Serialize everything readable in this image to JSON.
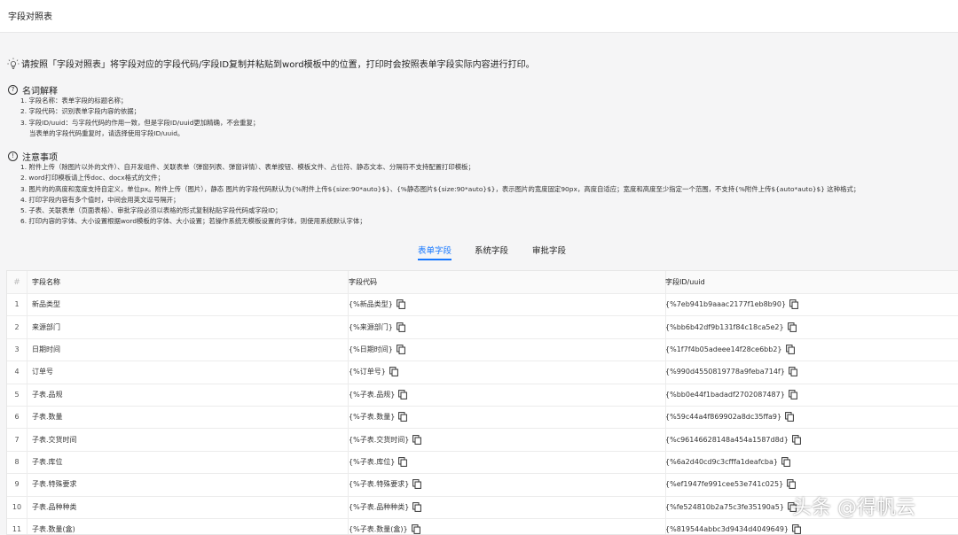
{
  "header": {
    "title": "字段对照表"
  },
  "tip": "请按照「字段对照表」将字段对应的字段代码/字段ID复制并粘贴到word模板中的位置，打印时会按照表单字段实际内容进行打印。",
  "glossary": {
    "title": "名词解释",
    "lines": [
      "1. 字段名称：表单字段的标题名称；",
      "2. 字段代码：识别表单字段内容的依据；",
      "3. 字段ID/uuid：与字段代码的作用一致，但是字段ID/uuid更加精确，不会重复；",
      "当表单的字段代码重复时，请选择使用字段ID/uuid。"
    ]
  },
  "notes": {
    "title": "注意事项",
    "lines": [
      "1. 附件上传（除图片以外的文件）、自开发组件、关联表单（弹窗列表、弹窗详情）、表单按钮、模板文件、占位符、静态文本、分隔符不支持配置打印模板；",
      "2. word打印模板请上传doc、docx格式的文件；",
      "3. 图片的的高度和宽度支持自定义，单位px。附件上传（图片），静态 图片的字段代码默认为{%附件上传${size:90*auto}$}、{%静态图片${size:90*auto}$}，表示图片的宽度固定90px，高度自适应；宽度和高度至少指定一个范围，不支持{%附件上传${auto*auto}$} 这种格式；",
      "4. 打印字段内容有多个值时，中间会用英文逗号隔开；",
      "5. 子表、关联表单（页面表格）、审批字段必须以表格的形式复制粘贴字段代码或字段ID；",
      "6. 打印内容的字体、大小设置根据word模板的字体、大小设置；若操作系统无模板设置的字体，则使用系统默认字体；"
    ]
  },
  "tabs": [
    {
      "label": "表单字段",
      "active": true
    },
    {
      "label": "系统字段",
      "active": false
    },
    {
      "label": "审批字段",
      "active": false
    }
  ],
  "table": {
    "columns": {
      "no": "#",
      "name": "字段名称",
      "code": "字段代码",
      "id": "字段ID/uuid"
    },
    "rows": [
      {
        "no": "1",
        "name": "新品类型",
        "code": "{%新品类型}",
        "id": "{%7eb941b9aaac2177f1eb8b90}"
      },
      {
        "no": "2",
        "name": "来源部门",
        "code": "{%来源部门}",
        "id": "{%bb6b42df9b131f84c18ca5e2}"
      },
      {
        "no": "3",
        "name": "日期时间",
        "code": "{%日期时间}",
        "id": "{%1f7f4b05adeee14f28ce6bb2}"
      },
      {
        "no": "4",
        "name": "订单号",
        "code": "{%订单号}",
        "id": "{%990d4550819778a9feba714f}"
      },
      {
        "no": "5",
        "name": "子表.品规",
        "code": "{%子表.品规}",
        "id": "{%bb0e44f1badadf2702087487}"
      },
      {
        "no": "6",
        "name": "子表.数量",
        "code": "{%子表.数量}",
        "id": "{%59c44a4f869902a8dc35ffa9}"
      },
      {
        "no": "7",
        "name": "子表.交货时间",
        "code": "{%子表.交货时间}",
        "id": "{%c96146628148a454a1587d8d}"
      },
      {
        "no": "8",
        "name": "子表.库位",
        "code": "{%子表.库位}",
        "id": "{%6a2d40cd9c3cfffa1deafcba}"
      },
      {
        "no": "9",
        "name": "子表.特殊要求",
        "code": "{%子表.特殊要求}",
        "id": "{%ef1947fe991cee53e741c025}"
      },
      {
        "no": "10",
        "name": "子表.品种种类",
        "code": "{%子表.品种种类}",
        "id": "{%fe524810b2a75c3fe35190a5}"
      },
      {
        "no": "11",
        "name": "子表.数量(盒)",
        "code": "{%子表.数量(盒)}",
        "id": "{%819544abbc3d9434d4049649}"
      }
    ]
  },
  "watermark": "头条 @得帆云",
  "colors": {
    "accent": "#1677ff",
    "background": "#f5f5f6"
  },
  "icons": [
    "lightbulb-icon",
    "question-circle-icon",
    "info-circle-icon",
    "copy-icon"
  ]
}
